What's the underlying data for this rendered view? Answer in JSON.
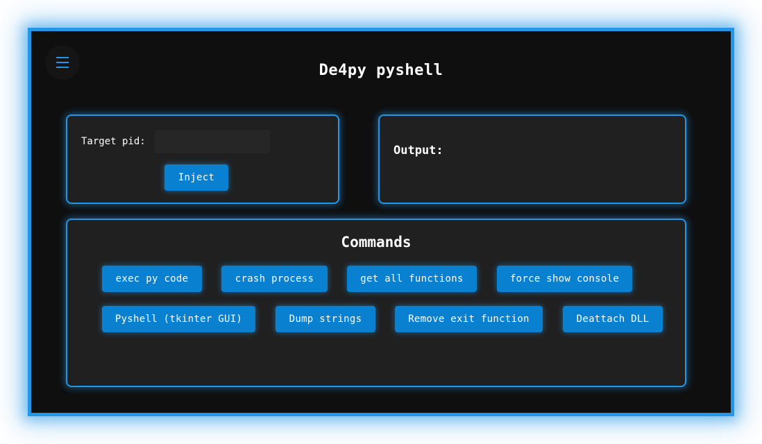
{
  "app": {
    "title": "De4py pyshell",
    "menu_icon": "hamburger-menu-icon",
    "accent_color": "#2596e6",
    "button_color": "#0a80d0",
    "background_color": "#0f0f0f",
    "panel_color": "#202020"
  },
  "inject": {
    "pid_label": "Target pid:",
    "pid_value": "",
    "pid_placeholder": "",
    "inject_label": "Inject"
  },
  "output": {
    "label": "Output:"
  },
  "commands": {
    "title": "Commands",
    "buttons": [
      "exec py code",
      "crash process",
      "get all functions",
      "force show console",
      "Pyshell (tkinter GUI)",
      "Dump strings",
      "Remove exit function",
      "Deattach DLL"
    ]
  }
}
